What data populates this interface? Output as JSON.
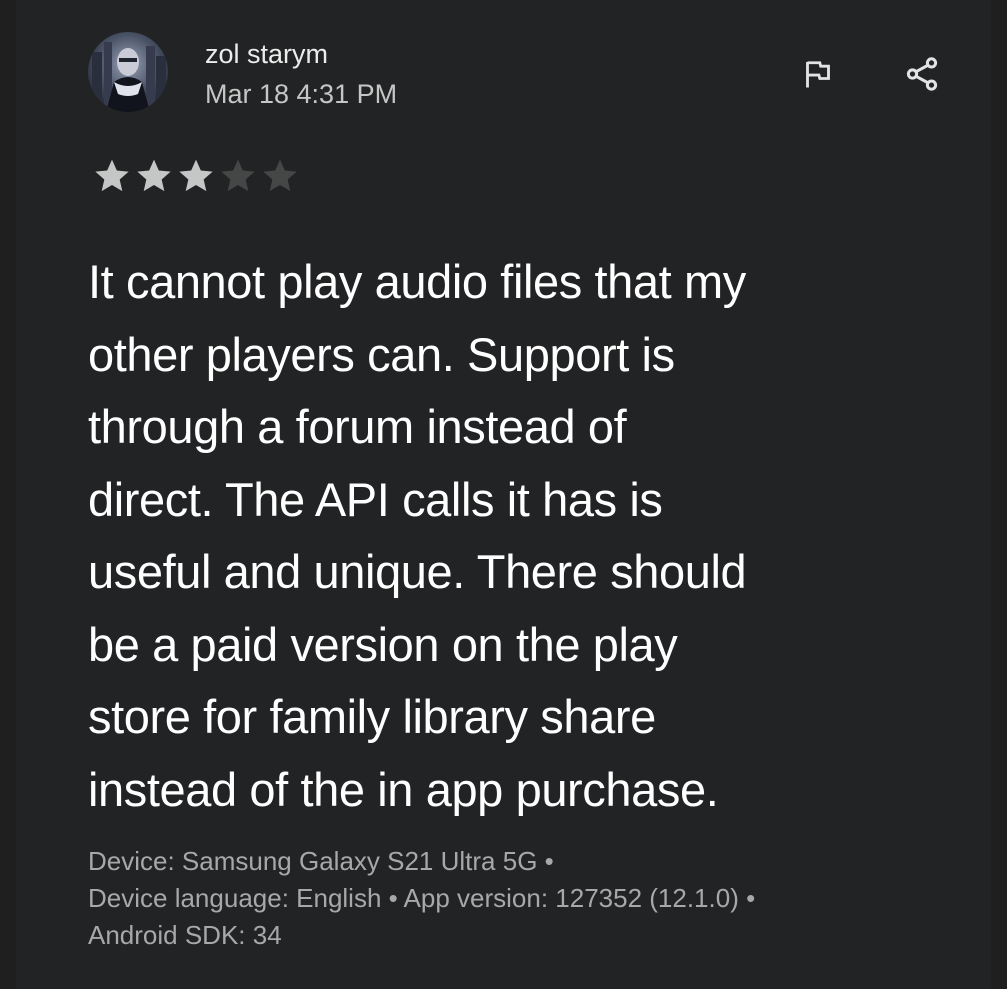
{
  "review": {
    "author": "zol starym",
    "date": "Mar 18 4:31 PM",
    "rating": 3,
    "rating_max": 5,
    "text_lines": [
      "It cannot play audio files that my",
      "other players can. Support is",
      "through a forum instead of",
      "direct. The API calls it has is",
      "useful and unique. There should",
      "be a paid version on the play",
      "store for family library share",
      "instead of the in app purchase."
    ],
    "meta_lines": [
      "Device: Samsung Galaxy S21 Ultra 5G •",
      "Device language: English • App version: 127352 (12.1.0) •",
      "Android SDK: 34"
    ]
  },
  "icons": {
    "flag": "flag-icon",
    "share": "share-icon",
    "star_filled": "star-filled-icon",
    "star_empty": "star-empty-icon"
  },
  "colors": {
    "background": "#1f1f1f",
    "card": "#222324",
    "star_filled": "#c4c7c5",
    "star_empty": "#444746",
    "text_primary": "#ffffff",
    "text_secondary": "#a6a8a9"
  }
}
